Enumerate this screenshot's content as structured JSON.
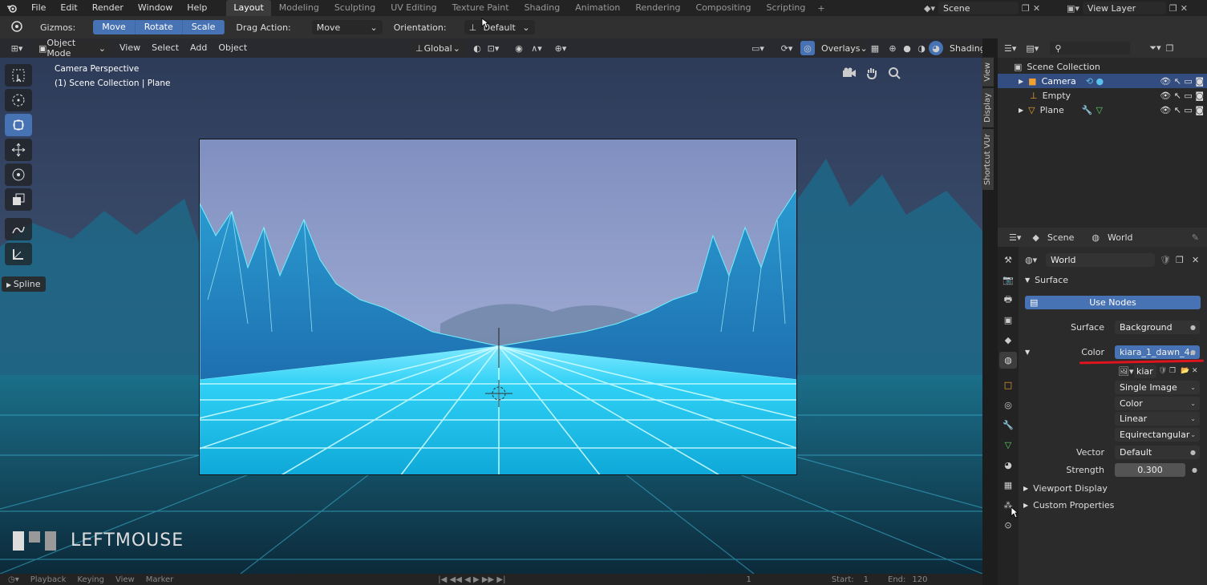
{
  "topbar": {
    "menus": [
      "File",
      "Edit",
      "Render",
      "Window",
      "Help"
    ],
    "workspaces": [
      "Layout",
      "Modeling",
      "Sculpting",
      "UV Editing",
      "Texture Paint",
      "Shading",
      "Animation",
      "Rendering",
      "Compositing",
      "Scripting"
    ],
    "active_workspace": "Layout",
    "scene": "Scene",
    "view_layer": "View Layer"
  },
  "toolheader": {
    "gizmos_label": "Gizmos:",
    "gizmo_modes": [
      "Move",
      "Rotate",
      "Scale"
    ],
    "drag_action_label": "Drag Action:",
    "drag_action_value": "Move",
    "orientation_label": "Orientation:",
    "orientation_value": "Default"
  },
  "viewport": {
    "mode": "Object Mode",
    "menus": [
      "View",
      "Select",
      "Add",
      "Object"
    ],
    "transform_orientation": "Global",
    "overlays": "Overlays",
    "shading": "Shading",
    "camera_label": "Camera Perspective",
    "collection_label": "(1) Scene Collection | Plane",
    "spline": "Spline",
    "keycast": "LEFTMOUSE",
    "side_tabs": [
      "View",
      "Display",
      "Shortcut VUr"
    ]
  },
  "timeline": {
    "items": [
      "Playback",
      "Keying",
      "View",
      "Marker"
    ],
    "frame": "1",
    "start_label": "Start:",
    "start": "1",
    "end_label": "End:",
    "end": "120"
  },
  "outliner": {
    "root": "Scene Collection",
    "items": [
      {
        "name": "Camera",
        "selected": true
      },
      {
        "name": "Empty",
        "selected": false
      },
      {
        "name": "Plane",
        "selected": false
      }
    ]
  },
  "properties": {
    "header_scene": "Scene",
    "header_world": "World",
    "world_name": "World",
    "surface_panel": "Surface",
    "use_nodes": "Use Nodes",
    "surface_label": "Surface",
    "surface_value": "Background",
    "color_label": "Color",
    "color_value": "kiara_1_dawn_4..",
    "image_name": "kiar",
    "image_options": [
      "Single Image",
      "Color",
      "Linear",
      "Equirectangular"
    ],
    "vector_label": "Vector",
    "vector_value": "Default",
    "strength_label": "Strength",
    "strength_value": "0.300",
    "collapsed_panels": [
      "Viewport Display",
      "Custom Properties"
    ]
  },
  "colors": {
    "accent": "#4772b3",
    "selected_row": "#334d80",
    "underline": "#e0141e",
    "grid": "#3fe0ff"
  }
}
